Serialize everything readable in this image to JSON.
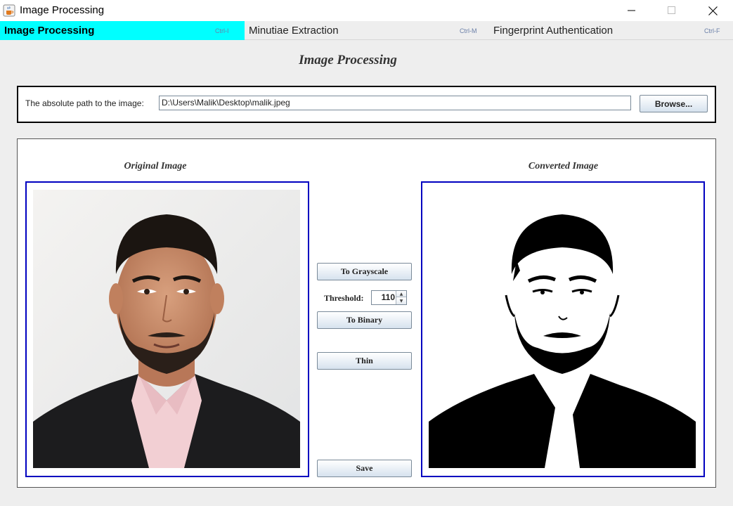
{
  "window": {
    "title": "Image Processing",
    "icons": [
      "java-cup-icon",
      "minimize-icon",
      "maximize-icon",
      "close-icon"
    ]
  },
  "tabs": [
    {
      "label": "Image Processing",
      "accelerator": "Ctrl-I",
      "active": true
    },
    {
      "label": "Minutiae Extraction",
      "accelerator": "Ctrl-M",
      "active": false
    },
    {
      "label": "Fingerprint Authentication",
      "accelerator": "Ctrl-F",
      "active": false
    }
  ],
  "page": {
    "title": "Image Processing"
  },
  "path": {
    "label": "The absolute path to the image:",
    "value": "D:\\Users\\Malik\\Desktop\\malik.jpeg",
    "browse_label": "Browse..."
  },
  "images": {
    "original_caption": "Original Image",
    "converted_caption": "Converted Image"
  },
  "controls": {
    "grayscale_label": "To Grayscale",
    "threshold_label": "Threshold:",
    "threshold_value": "110",
    "binary_label": "To Binary",
    "thin_label": "Thin",
    "save_label": "Save"
  },
  "colors": {
    "active_tab": "#00ffff",
    "image_frame": "#0000c0",
    "button_gradient_bottom": "#d6e2ee"
  }
}
